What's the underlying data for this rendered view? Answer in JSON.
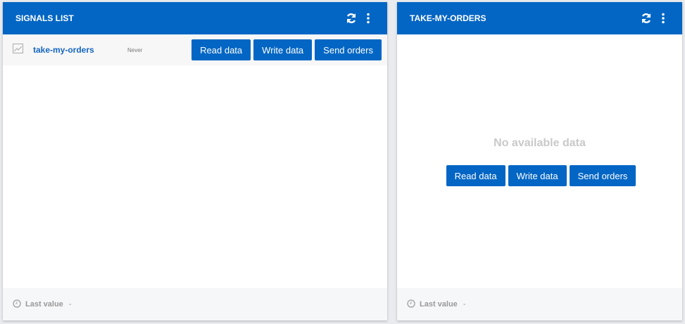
{
  "signals_panel": {
    "title": "SIGNALS LIST",
    "rows": [
      {
        "name": "take-my-orders",
        "last": "Never"
      }
    ],
    "footer_label": "Last value",
    "footer_value": "-"
  },
  "detail_panel": {
    "title": "TAKE-MY-ORDERS",
    "empty_text": "No available data",
    "footer_label": "Last value",
    "footer_value": "-"
  },
  "buttons": {
    "read": "Read data",
    "write": "Write data",
    "send": "Send orders"
  },
  "colors": {
    "primary": "#0366c4"
  }
}
